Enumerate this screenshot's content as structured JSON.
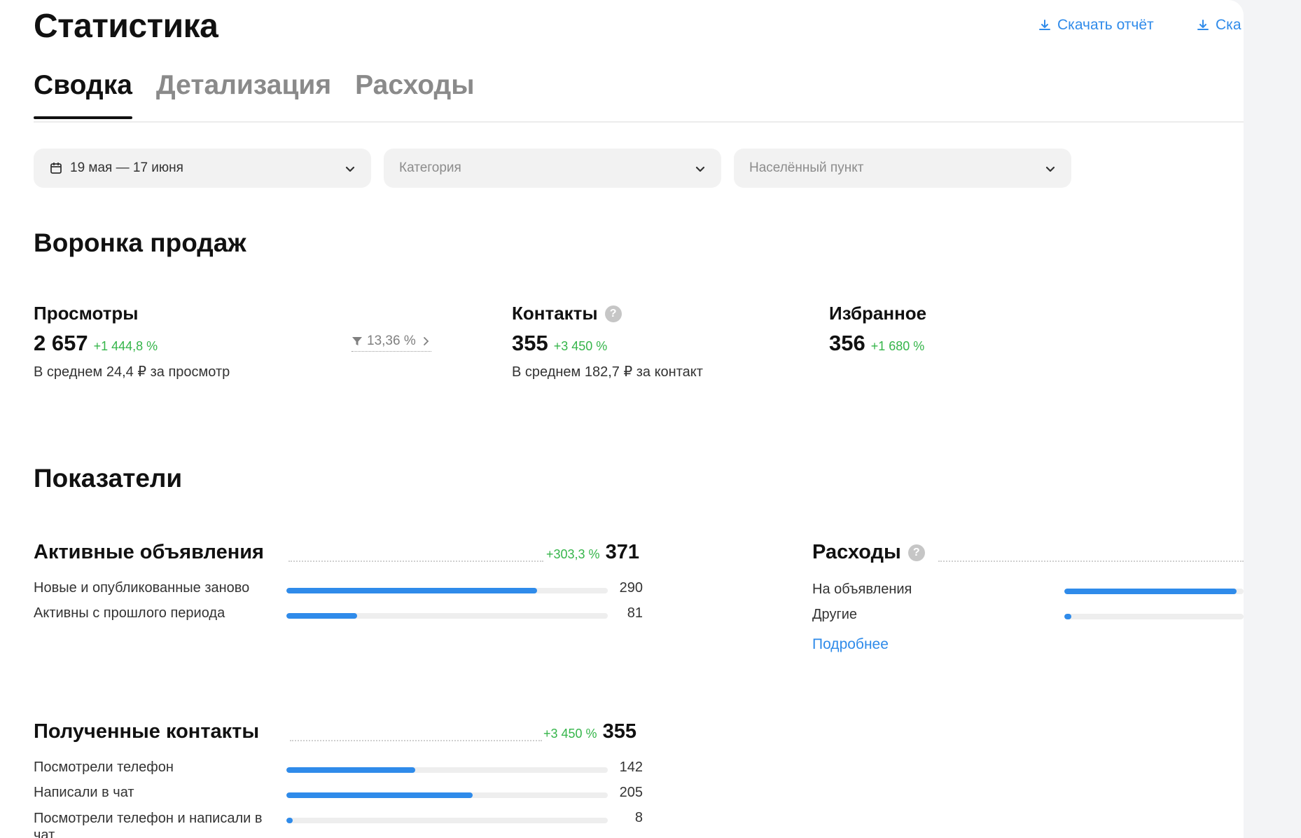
{
  "page": {
    "title": "Статистика"
  },
  "downloads": [
    {
      "label": "Скачать отчёт"
    },
    {
      "label": "Ска"
    }
  ],
  "tabs": [
    {
      "label": "Сводка",
      "active": true
    },
    {
      "label": "Детализация",
      "active": false
    },
    {
      "label": "Расходы",
      "active": false
    }
  ],
  "filters": {
    "date": {
      "value": "19 мая — 17 июня"
    },
    "category": {
      "placeholder": "Категория"
    },
    "locality": {
      "placeholder": "Населённый пункт"
    }
  },
  "funnel": {
    "title": "Воронка продаж",
    "views": {
      "label": "Просмотры",
      "value": "2 657",
      "delta": "+1 444,8 %",
      "sub": "В среднем 24,4 ₽ за просмотр"
    },
    "conversion": {
      "value": "13,36 %"
    },
    "contacts": {
      "label": "Контакты",
      "help": "?",
      "value": "355",
      "delta": "+3 450 %",
      "sub": "В среднем 182,7 ₽ за контакт"
    },
    "favorites": {
      "label": "Избранное",
      "value": "356",
      "delta": "+1 680 %"
    }
  },
  "indicators": {
    "title": "Показатели",
    "active_ads": {
      "title": "Активные объявления",
      "delta": "+303,3 %",
      "total": "371",
      "rows": [
        {
          "label": "Новые и опубликованные заново",
          "value": "290",
          "fill": 0.78
        },
        {
          "label": "Активны с прошлого периода",
          "value": "81",
          "fill": 0.22
        }
      ]
    },
    "expenses": {
      "title": "Расходы",
      "help": "?",
      "rows": [
        {
          "label": "На объявления",
          "fill": 0.96
        },
        {
          "label": "Другие",
          "fill": 0.04
        }
      ],
      "more": "Подробнее"
    },
    "received_contacts": {
      "title": "Полученные контакты",
      "delta": "+3 450 %",
      "total": "355",
      "rows": [
        {
          "label": "Посмотрели телефон",
          "value": "142",
          "fill": 0.4
        },
        {
          "label": "Написали в чат",
          "value": "205",
          "fill": 0.58
        },
        {
          "label": "Посмотрели телефон и написали в чат",
          "value": "8",
          "fill": 0.02
        }
      ]
    }
  },
  "colors": {
    "accent": "#2f8bea",
    "positive": "#35b54a",
    "track": "#eeeeee"
  },
  "icons": {
    "download": "download-icon",
    "calendar": "calendar-icon",
    "chevron": "chevron-down-icon",
    "funnel": "funnel-icon",
    "help": "help-icon"
  }
}
